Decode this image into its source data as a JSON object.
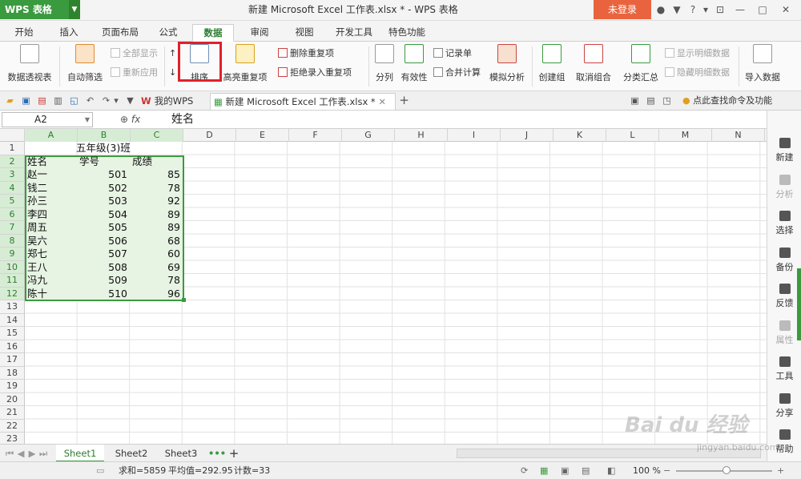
{
  "titlebar": {
    "app_name": "WPS 表格",
    "doc_title": "新建 Microsoft Excel 工作表.xlsx * - WPS 表格",
    "login": "未登录"
  },
  "menu_tabs": [
    "开始",
    "插入",
    "页面布局",
    "公式",
    "数据",
    "审阅",
    "视图",
    "开发工具",
    "特色功能"
  ],
  "active_tab": "数据",
  "ribbon": {
    "pivot": "数据透视表",
    "auto_filter": "自动筛选",
    "show_all": "全部显示",
    "reapply": "重新应用",
    "sort": "排序",
    "highlight_dup": "高亮重复项",
    "remove_dup": "删除重复项",
    "reject_dup": "拒绝录入重复项",
    "split": "分列",
    "validity": "有效性",
    "record_form": "记录单",
    "consolidate": "合并计算",
    "what_if": "模拟分析",
    "create_group": "创建组",
    "ungroup": "取消组合",
    "subtotal": "分类汇总",
    "show_detail": "显示明细数据",
    "hide_detail": "隐藏明细数据",
    "import_data": "导入数据"
  },
  "doc_tabs": {
    "mywps": "我的WPS",
    "file": "新建 Microsoft Excel 工作表.xlsx *",
    "help": "点此查找命令及功能"
  },
  "formula": {
    "cell_ref": "A2",
    "fx": "fx",
    "content": "姓名"
  },
  "columns": [
    "A",
    "B",
    "C",
    "D",
    "E",
    "F",
    "G",
    "H",
    "I",
    "J",
    "K",
    "L",
    "M",
    "N"
  ],
  "rows": [
    "1",
    "2",
    "3",
    "4",
    "5",
    "6",
    "7",
    "8",
    "9",
    "10",
    "11",
    "12",
    "13",
    "14",
    "15",
    "16",
    "17",
    "18",
    "19",
    "20",
    "21",
    "22",
    "23"
  ],
  "table": {
    "title": "五年级(3)班",
    "headers": [
      "姓名",
      "学号",
      "成绩"
    ],
    "records": [
      [
        "赵一",
        "501",
        "85"
      ],
      [
        "钱二",
        "502",
        "78"
      ],
      [
        "孙三",
        "503",
        "92"
      ],
      [
        "李四",
        "504",
        "89"
      ],
      [
        "周五",
        "505",
        "89"
      ],
      [
        "吴六",
        "506",
        "68"
      ],
      [
        "郑七",
        "507",
        "60"
      ],
      [
        "王八",
        "508",
        "69"
      ],
      [
        "冯九",
        "509",
        "78"
      ],
      [
        "陈十",
        "510",
        "96"
      ]
    ]
  },
  "sheets": [
    "Sheet1",
    "Sheet2",
    "Sheet3"
  ],
  "status": {
    "sum": "求和=5859",
    "avg": "平均值=292.95",
    "count": "计数=33",
    "zoom": "100 %"
  },
  "side_panel": [
    {
      "label": "新建",
      "dim": false
    },
    {
      "label": "分析",
      "dim": true
    },
    {
      "label": "选择",
      "dim": false
    },
    {
      "label": "备份",
      "dim": false
    },
    {
      "label": "反馈",
      "dim": false
    },
    {
      "label": "属性",
      "dim": true
    },
    {
      "label": "工具",
      "dim": false
    },
    {
      "label": "分享",
      "dim": false
    },
    {
      "label": "帮助",
      "dim": false
    }
  ],
  "watermark": {
    "text": "Bai du 经验",
    "url": "jingyan.baidu.com"
  },
  "colors": {
    "accent": "#3a9a3e",
    "login": "#e9643e",
    "highlight": "#e0212a"
  }
}
